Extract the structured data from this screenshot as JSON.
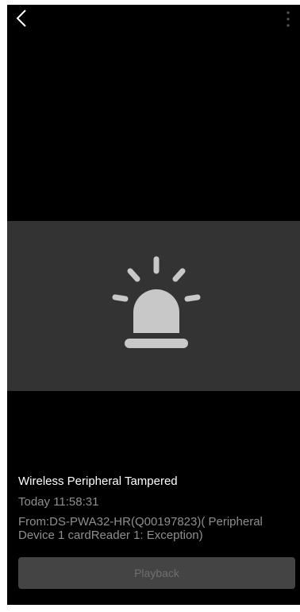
{
  "toolbar": {
    "back_icon": "chevron-left-icon",
    "more_icon": "more-vertical-icon"
  },
  "preview": {
    "icon": "alarm-siren-icon"
  },
  "event": {
    "title": "Wireless Peripheral Tampered",
    "time": "Today 11:58:31",
    "source": "From:DS-PWA32-HR(Q00197823)( Peripheral Device 1 cardReader 1: Exception)"
  },
  "actions": {
    "playback_label": "Playback"
  },
  "colors": {
    "background": "#000000",
    "preview_panel": "#333333",
    "icon": "#c8c8c8",
    "title_text": "#ffffff",
    "secondary_text": "#8f8f8f",
    "button_bg": "#444444",
    "button_text": "#6f6f6f"
  }
}
